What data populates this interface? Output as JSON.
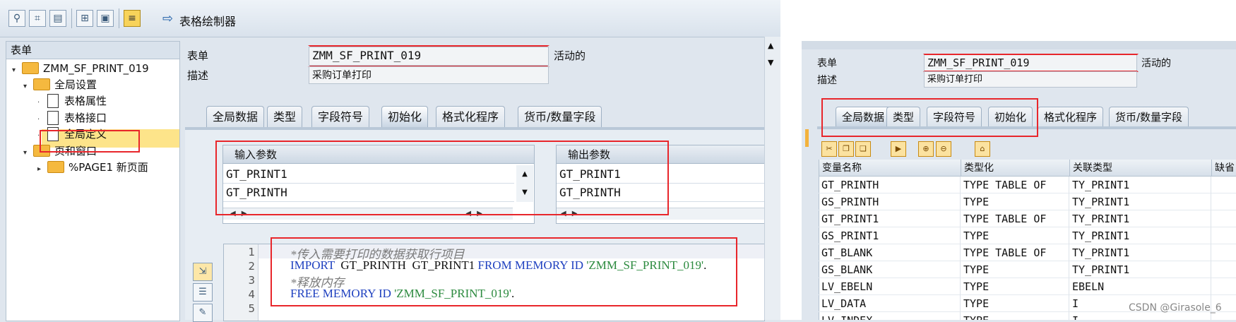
{
  "toolbar": {
    "form_painter_label": "表格绘制器",
    "icons": [
      "glasses-icon",
      "hierarchy-icon",
      "print-preview-icon",
      "add-node-icon",
      "doc-node-icon",
      "field-list-icon",
      "form-painter-arrow-icon"
    ]
  },
  "tree": {
    "header": "表单",
    "items": [
      {
        "label": "ZMM_SF_PRINT_019",
        "icon": "folder-icon",
        "expanded": true
      },
      {
        "label": "全局设置",
        "icon": "folder-icon",
        "expanded": true
      },
      {
        "label": "表格属性",
        "icon": "document-icon"
      },
      {
        "label": "表格接口",
        "icon": "document-icon"
      },
      {
        "label": "全局定义",
        "icon": "document-icon",
        "selected": true
      },
      {
        "label": "页和窗口",
        "icon": "folder-icon",
        "expanded": true
      },
      {
        "label": "%PAGE1 新页面",
        "icon": "folder-icon",
        "expanded": false
      }
    ]
  },
  "form": {
    "form_label": "表单",
    "form_value": "ZMM_SF_PRINT_019",
    "status": "活动的",
    "desc_label": "描述",
    "desc_value": "采购订单打印"
  },
  "tabs": [
    "全局数据",
    "类型",
    "字段符号",
    "初始化",
    "格式化程序",
    "货币/数量字段"
  ],
  "active_tab": "初始化",
  "input_params": {
    "header": "输入参数",
    "rows": [
      "GT_PRINT1",
      "GT_PRINTH"
    ]
  },
  "output_params": {
    "header": "输出参数",
    "rows": [
      "GT_PRINT1",
      "GT_PRINTH"
    ]
  },
  "code": {
    "line_numbers": [
      "1",
      "2",
      "3",
      "4",
      "5"
    ],
    "lines": [
      {
        "comment": "*传入需要打印的数据获取行项目"
      },
      {
        "kw1": "IMPORT",
        "plain": "  GT_PRINTH  GT_PRINT1 ",
        "kw2": "FROM MEMORY ID",
        "str": "'ZMM_SF_PRINT_019'",
        "end": "."
      },
      {
        "comment": "*释放内存"
      },
      {
        "kw1": "FREE MEMORY ID",
        "str": "'ZMM_SF_PRINT_019'",
        "end": "."
      }
    ]
  },
  "right": {
    "form_label": "表单",
    "form_value": "ZMM_SF_PRINT_019",
    "status": "活动的",
    "desc_label": "描述",
    "desc_value": "采购订单打印",
    "tabs": [
      "全局数据",
      "类型",
      "字段符号",
      "初始化",
      "格式化程序",
      "货币/数量字段"
    ],
    "active_tab": "全局数据",
    "columns": [
      "变量名称",
      "类型化",
      "关联类型",
      "缺省"
    ],
    "rows": [
      [
        "GT_PRINTH",
        "TYPE TABLE OF",
        "TY_PRINT1"
      ],
      [
        "GS_PRINTH",
        "TYPE",
        "TY_PRINT1"
      ],
      [
        "GT_PRINT1",
        "TYPE TABLE OF",
        "TY_PRINT1"
      ],
      [
        "GS_PRINT1",
        "TYPE",
        "TY_PRINT1"
      ],
      [
        "GT_BLANK",
        "TYPE TABLE OF",
        "TY_PRINT1"
      ],
      [
        "GS_BLANK",
        "TYPE",
        "TY_PRINT1"
      ],
      [
        "LV_EBELN",
        "TYPE",
        "EBELN"
      ],
      [
        "LV_DATA",
        "TYPE",
        "I"
      ],
      [
        "LV_INDEX",
        "TYPE",
        "I"
      ]
    ]
  },
  "watermark": "CSDN @Girasole_6",
  "colors": {
    "highlight_red": "#e8262b",
    "selection": "#fde48a",
    "keyword_blue": "#1d3fbf",
    "string_green": "#2b8a3e"
  }
}
